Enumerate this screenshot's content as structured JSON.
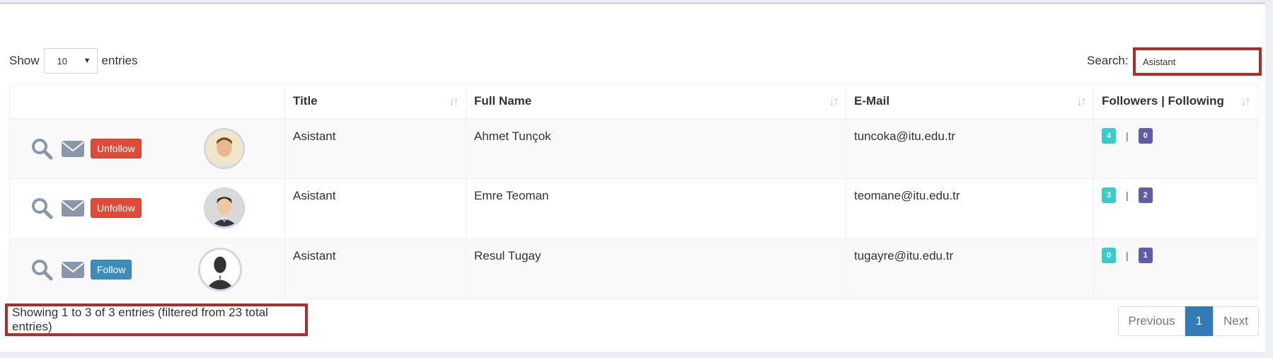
{
  "controls": {
    "show_label": "Show",
    "entries_label": "entries",
    "page_length": "10",
    "search_label": "Search:",
    "search_value": "Asistant"
  },
  "table": {
    "headers": [
      "Title",
      "Full Name",
      "E-Mail",
      "Followers | Following"
    ],
    "rows": [
      {
        "action_label": "Unfollow",
        "title": "Asistant",
        "full_name": "Ahmet Tunçok",
        "email": "tuncoka@itu.edu.tr",
        "followers": "4",
        "following": "0"
      },
      {
        "action_label": "Unfollow",
        "title": "Asistant",
        "full_name": "Emre Teoman",
        "email": "teomane@itu.edu.tr",
        "followers": "3",
        "following": "2"
      },
      {
        "action_label": "Follow",
        "title": "Asistant",
        "full_name": "Resul Tugay",
        "email": "tugayre@itu.edu.tr",
        "followers": "0",
        "following": "1"
      }
    ],
    "separator": "|"
  },
  "footer": {
    "info": "Showing 1 to 3 of 3 entries (filtered from 23 total entries)",
    "previous": "Previous",
    "current_page": "1",
    "next": "Next"
  },
  "colors": {
    "highlight_border": "#b22a2a",
    "unfollow_button": "#dd4b39",
    "follow_button": "#3c8dbc",
    "followers_badge": "#39cccc",
    "following_badge": "#605ca8",
    "active_page": "#337ab7"
  },
  "icons": [
    "search-icon",
    "mail-icon",
    "sort-icon",
    "dropdown-arrow-icon"
  ]
}
